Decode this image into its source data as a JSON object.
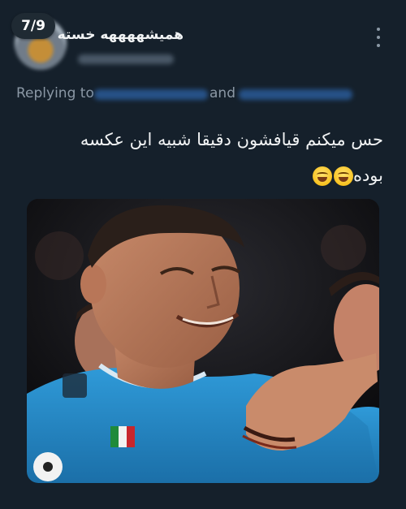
{
  "header": {
    "page_indicator": "7/9",
    "display_name": "همیشههههه خسته"
  },
  "reply": {
    "prefix": "Replying to",
    "conjunction": "and"
  },
  "tweet": {
    "line1": "حس میکنم قیافشون دقیقا شبیه این عکسه",
    "line2": "بوده"
  },
  "media": {
    "jersey_color": "#2a8fd0"
  },
  "icons": {
    "more": "more-vertical-icon",
    "emoji": "laughing-emoji-icon"
  }
}
